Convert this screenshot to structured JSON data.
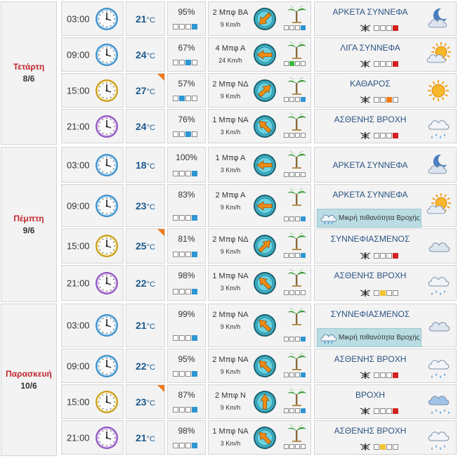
{
  "temp_unit": "°C",
  "colors": {
    "day_name": "#c0282e",
    "temperature": "#1d5a8e",
    "sky_text": "#2a5382",
    "level_blue": "#2d96d3",
    "level_green": "#3cb83c",
    "level_red": "#d32020",
    "level_orange": "#f07b1a",
    "level_yellow": "#f2c230",
    "rain_banner": "#b9dde3",
    "warm_flag": "#f07b1a"
  },
  "days": [
    {
      "name": "Τετάρτη",
      "date": "8/6",
      "rows": [
        {
          "time": "03:00",
          "clock": "blue",
          "temp": "21",
          "warm": false,
          "hum": "95%",
          "hum_level": 4,
          "wind": "2 Μπφ ΒΑ",
          "speed": "9 Km/h",
          "wind_dir_deg": 225,
          "wind_level": 4,
          "wind_color": "blue",
          "sky": "ΑΡΚΕΤΑ ΣΥΝΝΕΦΑ",
          "icon": "moon-cloud-icon",
          "mosq_level": 4,
          "mosq_color": "red",
          "rain_note": ""
        },
        {
          "time": "09:00",
          "clock": "blue",
          "temp": "24",
          "warm": false,
          "hum": "67%",
          "hum_level": 3,
          "wind": "4 Μπφ Α",
          "speed": "24 Km/h",
          "wind_dir_deg": 270,
          "wind_level": 2,
          "wind_color": "green",
          "sky": "ΛΙΓΑ ΣΥΝΝΕΦΑ",
          "icon": "sun-cloud-icon",
          "mosq_level": 4,
          "mosq_color": "red",
          "rain_note": ""
        },
        {
          "time": "15:00",
          "clock": "yellow",
          "temp": "27",
          "warm": true,
          "hum": "57%",
          "hum_level": 2,
          "wind": "2 Μπφ ΝΔ",
          "speed": "9 Km/h",
          "wind_dir_deg": 45,
          "wind_level": 4,
          "wind_color": "blue",
          "sky": "ΚΑΘΑΡΟΣ",
          "icon": "sun-icon",
          "mosq_level": 3,
          "mosq_color": "orange",
          "rain_note": ""
        },
        {
          "time": "21:00",
          "clock": "purple",
          "temp": "24",
          "warm": false,
          "hum": "76%",
          "hum_level": 3,
          "wind": "1 Μπφ ΝΑ",
          "speed": "3 Km/h",
          "wind_dir_deg": 315,
          "wind_level": 0,
          "wind_color": "blue",
          "sky": "ΑΣΘΕΝΗΣ ΒΡΟΧΗ",
          "icon": "rain-icon",
          "mosq_level": 4,
          "mosq_color": "red",
          "rain_note": ""
        }
      ]
    },
    {
      "name": "Πέμπτη",
      "date": "9/6",
      "rows": [
        {
          "time": "03:00",
          "clock": "blue",
          "temp": "18",
          "warm": false,
          "hum": "100%",
          "hum_level": 4,
          "wind": "1 Μπφ Α",
          "speed": "3 Km/h",
          "wind_dir_deg": 270,
          "wind_level": 0,
          "wind_color": "blue",
          "sky": "ΑΡΚΕΤΑ ΣΥΝΝΕΦΑ",
          "icon": "moon-cloud-icon",
          "mosq_level": 0,
          "mosq_color": "none",
          "rain_note": ""
        },
        {
          "time": "09:00",
          "clock": "blue",
          "temp": "23",
          "warm": false,
          "hum": "83%",
          "hum_level": 4,
          "wind": "2 Μπφ Α",
          "speed": "9 Km/h",
          "wind_dir_deg": 270,
          "wind_level": 4,
          "wind_color": "blue",
          "sky": "ΑΡΚΕΤΑ ΣΥΝΝΕΦΑ",
          "icon": "sun-cloud-icon",
          "mosq_level": 0,
          "mosq_color": "none",
          "rain_note": "Μικρή πιθανότητα Βροχής"
        },
        {
          "time": "15:00",
          "clock": "yellow",
          "temp": "25",
          "warm": true,
          "hum": "81%",
          "hum_level": 4,
          "wind": "2 Μπφ ΝΔ",
          "speed": "9 Km/h",
          "wind_dir_deg": 45,
          "wind_level": 4,
          "wind_color": "blue",
          "sky": "ΣΥΝΝΕΦΙΑΣΜΕΝΟΣ",
          "icon": "cloud-icon",
          "mosq_level": 4,
          "mosq_color": "red",
          "rain_note": ""
        },
        {
          "time": "21:00",
          "clock": "purple",
          "temp": "22",
          "warm": false,
          "hum": "98%",
          "hum_level": 4,
          "wind": "1 Μπφ ΝΑ",
          "speed": "3 Km/h",
          "wind_dir_deg": 315,
          "wind_level": 0,
          "wind_color": "blue",
          "sky": "ΑΣΘΕΝΗΣ ΒΡΟΧΗ",
          "icon": "rain-icon",
          "mosq_level": 2,
          "mosq_color": "yellow",
          "rain_note": ""
        }
      ]
    },
    {
      "name": "Παρασκευή",
      "date": "10/6",
      "rows": [
        {
          "time": "03:00",
          "clock": "blue",
          "temp": "21",
          "warm": false,
          "hum": "99%",
          "hum_level": 4,
          "wind": "2 Μπφ ΝΑ",
          "speed": "9 Km/h",
          "wind_dir_deg": 315,
          "wind_level": 4,
          "wind_color": "blue",
          "sky": "ΣΥΝΝΕΦΙΑΣΜΕΝΟΣ",
          "icon": "cloud-icon",
          "mosq_level": 0,
          "mosq_color": "none",
          "rain_note": "Μικρή πιθανότητα Βροχής"
        },
        {
          "time": "09:00",
          "clock": "blue",
          "temp": "22",
          "warm": false,
          "hum": "95%",
          "hum_level": 4,
          "wind": "2 Μπφ ΝΑ",
          "speed": "9 Km/h",
          "wind_dir_deg": 315,
          "wind_level": 4,
          "wind_color": "blue",
          "sky": "ΑΣΘΕΝΗΣ ΒΡΟΧΗ",
          "icon": "rain-icon",
          "mosq_level": 4,
          "mosq_color": "red",
          "rain_note": ""
        },
        {
          "time": "15:00",
          "clock": "yellow",
          "temp": "23",
          "warm": true,
          "hum": "87%",
          "hum_level": 4,
          "wind": "2 Μπφ Ν",
          "speed": "9 Km/h",
          "wind_dir_deg": 0,
          "wind_level": 4,
          "wind_color": "blue",
          "sky": "ΒΡΟΧΗ",
          "icon": "heavy-rain-icon",
          "mosq_level": 4,
          "mosq_color": "red",
          "rain_note": ""
        },
        {
          "time": "21:00",
          "clock": "purple",
          "temp": "21",
          "warm": false,
          "hum": "98%",
          "hum_level": 4,
          "wind": "1 Μπφ ΝΑ",
          "speed": "3 Km/h",
          "wind_dir_deg": 315,
          "wind_level": 0,
          "wind_color": "blue",
          "sky": "ΑΣΘΕΝΗΣ ΒΡΟΧΗ",
          "icon": "rain-icon",
          "mosq_level": 2,
          "mosq_color": "yellow",
          "rain_note": ""
        }
      ]
    }
  ]
}
